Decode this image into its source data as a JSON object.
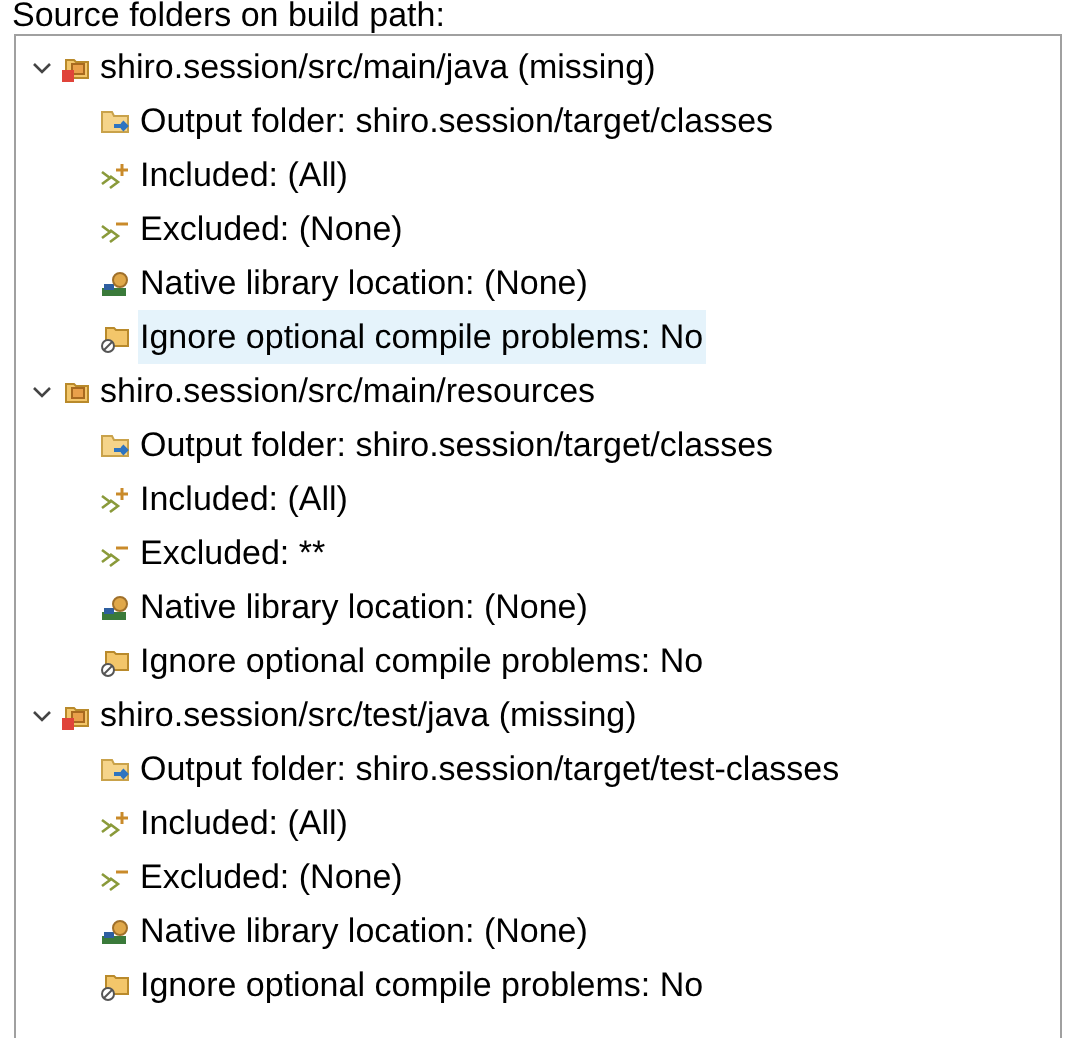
{
  "label": "Source folders on build path:",
  "tree": [
    {
      "label": "shiro.session/src/main/java (missing)",
      "missing": true,
      "expanded": true,
      "children": [
        {
          "kind": "output",
          "label": "Output folder: shiro.session/target/classes",
          "selected": false
        },
        {
          "kind": "included",
          "label": "Included: (All)",
          "selected": false
        },
        {
          "kind": "excluded",
          "label": "Excluded: (None)",
          "selected": false
        },
        {
          "kind": "native",
          "label": "Native library location: (None)",
          "selected": false
        },
        {
          "kind": "ignore",
          "label": "Ignore optional compile problems: No",
          "selected": true
        }
      ]
    },
    {
      "label": "shiro.session/src/main/resources",
      "missing": false,
      "expanded": true,
      "children": [
        {
          "kind": "output",
          "label": "Output folder: shiro.session/target/classes",
          "selected": false
        },
        {
          "kind": "included",
          "label": "Included: (All)",
          "selected": false
        },
        {
          "kind": "excluded",
          "label": "Excluded: **",
          "selected": false
        },
        {
          "kind": "native",
          "label": "Native library location: (None)",
          "selected": false
        },
        {
          "kind": "ignore",
          "label": "Ignore optional compile problems: No",
          "selected": false
        }
      ]
    },
    {
      "label": "shiro.session/src/test/java (missing)",
      "missing": true,
      "expanded": true,
      "children": [
        {
          "kind": "output",
          "label": "Output folder: shiro.session/target/test-classes",
          "selected": false
        },
        {
          "kind": "included",
          "label": "Included: (All)",
          "selected": false
        },
        {
          "kind": "excluded",
          "label": "Excluded: (None)",
          "selected": false
        },
        {
          "kind": "native",
          "label": "Native library location: (None)",
          "selected": false
        },
        {
          "kind": "ignore",
          "label": "Ignore optional compile problems: No",
          "selected": false
        }
      ]
    }
  ]
}
